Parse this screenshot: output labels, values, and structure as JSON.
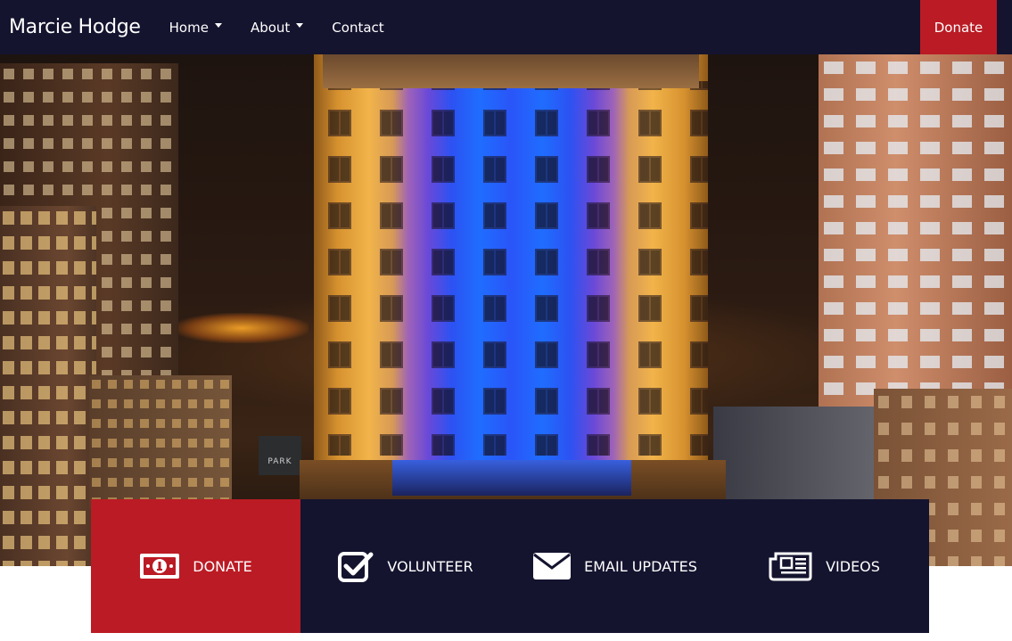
{
  "navbar": {
    "brand": "Marcie Hodge",
    "items": [
      {
        "label": "Home",
        "dropdown": true
      },
      {
        "label": "About",
        "dropdown": true
      },
      {
        "label": "Contact",
        "dropdown": false
      }
    ],
    "donate_label": "Donate"
  },
  "hero": {
    "sign_text": "PARK"
  },
  "actions": [
    {
      "label": "DONATE",
      "icon": "money-bill-icon"
    },
    {
      "label": "VOLUNTEER",
      "icon": "checkbox-icon"
    },
    {
      "label": "EMAIL UPDATES",
      "icon": "envelope-icon"
    },
    {
      "label": "VIDEOS",
      "icon": "newspaper-icon"
    }
  ],
  "colors": {
    "navy": "#14142f",
    "red": "#bb1b24",
    "white": "#ffffff"
  }
}
